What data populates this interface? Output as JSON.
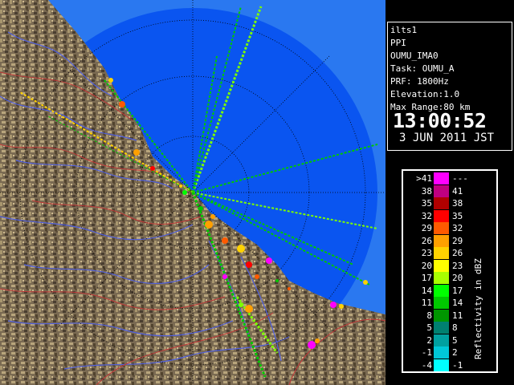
{
  "info": {
    "site": "ilts1",
    "scan_type": "PPI",
    "radar_id": "OUMU_IMA0",
    "task": "Task: OUMU_A",
    "prf": "PRF: 1800Hz",
    "elevation": "Elevation:1.0",
    "max_range": "Max Range:80 km",
    "time": "13:00:52",
    "date": "3 JUN 2011 JST"
  },
  "legend": {
    "title": "Reflectivity in dBZ",
    "rows": [
      {
        "low": ">41",
        "high": "---",
        "color": "#ff00ff"
      },
      {
        "low": "38",
        "high": "41",
        "color": "#c00080"
      },
      {
        "low": "35",
        "high": "38",
        "color": "#b00000"
      },
      {
        "low": "32",
        "high": "35",
        "color": "#ff0000"
      },
      {
        "low": "29",
        "high": "32",
        "color": "#ff5a00"
      },
      {
        "low": "26",
        "high": "29",
        "color": "#ffa000"
      },
      {
        "low": "23",
        "high": "26",
        "color": "#ffd200"
      },
      {
        "low": "20",
        "high": "23",
        "color": "#ffff00"
      },
      {
        "low": "17",
        "high": "20",
        "color": "#a8ff00"
      },
      {
        "low": "14",
        "high": "17",
        "color": "#00ff00"
      },
      {
        "low": "11",
        "high": "14",
        "color": "#00c800"
      },
      {
        "low": "8",
        "high": "11",
        "color": "#009600"
      },
      {
        "low": "5",
        "high": "8",
        "color": "#008070"
      },
      {
        "low": "2",
        "high": "5",
        "color": "#00a0a0"
      },
      {
        "low": "-1",
        "high": "2",
        "color": "#00c8d8"
      },
      {
        "low": "-4",
        "high": "-1",
        "color": "#00ffff"
      }
    ]
  },
  "colors": {
    "sea": "#0a55f0",
    "outer_sea": "#2a78f0",
    "land": "#7a6a52",
    "land_light": "#a8966e",
    "land_dark": "#4a3e30",
    "river": "#5060e0",
    "border": "#c03838",
    "range_ring": "#000000"
  }
}
